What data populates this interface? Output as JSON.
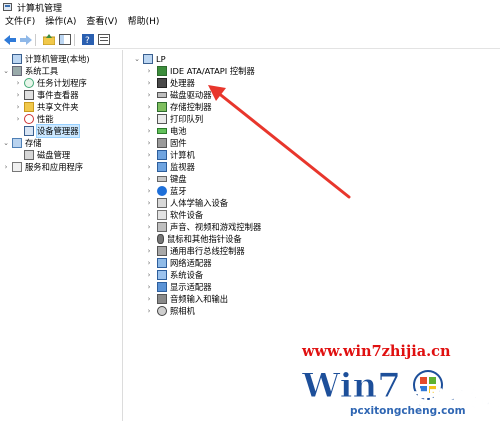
{
  "window": {
    "title": "计算机管理"
  },
  "menu": [
    "文件(F)",
    "操作(A)",
    "查看(V)",
    "帮助(H)"
  ],
  "tree": {
    "root": "计算机管理(本地)",
    "items": [
      {
        "label": "系统工具",
        "icon": "tools-icon"
      },
      {
        "label": "任务计划程序",
        "icon": "clock-icon"
      },
      {
        "label": "事件查看器",
        "icon": "event-log-icon"
      },
      {
        "label": "共享文件夹",
        "icon": "folder-icon"
      },
      {
        "label": "性能",
        "icon": "performance-icon"
      },
      {
        "label": "设备管理器",
        "icon": "device-manager-icon"
      },
      {
        "label": "存储",
        "icon": "storage-icon"
      },
      {
        "label": "磁盘管理",
        "icon": "disk-management-icon"
      },
      {
        "label": "服务和应用程序",
        "icon": "services-icon"
      }
    ]
  },
  "devices": {
    "computer": "LP",
    "categories": [
      {
        "label": "IDE ATA/ATAPI 控制器",
        "icon": "ide-controller-icon"
      },
      {
        "label": "处理器",
        "icon": "processor-icon"
      },
      {
        "label": "磁盘驱动器",
        "icon": "disk-drive-icon"
      },
      {
        "label": "存储控制器",
        "icon": "storage-controller-icon"
      },
      {
        "label": "打印队列",
        "icon": "printer-icon"
      },
      {
        "label": "电池",
        "icon": "battery-icon"
      },
      {
        "label": "固件",
        "icon": "firmware-icon"
      },
      {
        "label": "计算机",
        "icon": "computer-icon"
      },
      {
        "label": "监视器",
        "icon": "monitor-icon"
      },
      {
        "label": "键盘",
        "icon": "keyboard-icon"
      },
      {
        "label": "蓝牙",
        "icon": "bluetooth-icon"
      },
      {
        "label": "人体学输入设备",
        "icon": "hid-icon"
      },
      {
        "label": "软件设备",
        "icon": "software-device-icon"
      },
      {
        "label": "声音、视频和游戏控制器",
        "icon": "sound-controller-icon"
      },
      {
        "label": "鼠标和其他指针设备",
        "icon": "mouse-icon"
      },
      {
        "label": "通用串行总线控制器",
        "icon": "usb-icon"
      },
      {
        "label": "网络适配器",
        "icon": "network-adapter-icon"
      },
      {
        "label": "系统设备",
        "icon": "system-device-icon"
      },
      {
        "label": "显示适配器",
        "icon": "display-adapter-icon"
      },
      {
        "label": "音频输入和输出",
        "icon": "audio-io-icon"
      },
      {
        "label": "照相机",
        "icon": "camera-icon"
      }
    ]
  },
  "watermark": {
    "url": "www.win7zhijia.cn",
    "logo_text": "Win7",
    "brand": "电脑系统城",
    "site": "pcxitongcheng.com"
  },
  "colors": {
    "annotation_arrow": "#e8362c",
    "selection": "#cce8ff",
    "watermark_red": "#e01010",
    "watermark_blue": "#2f66b3"
  }
}
